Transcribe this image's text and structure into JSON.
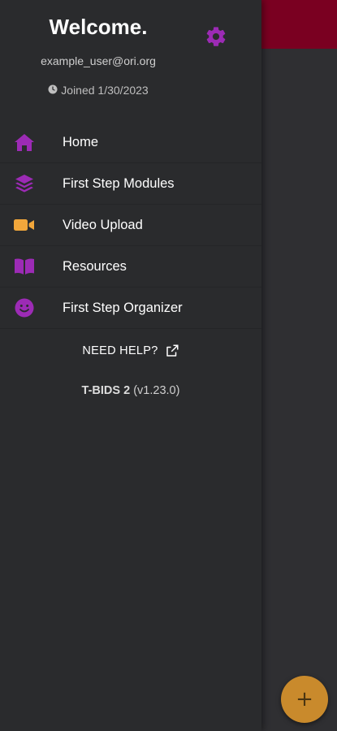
{
  "drawer": {
    "welcome": "Welcome.",
    "email": "example_user@ori.org",
    "joined": "Joined 1/30/2023",
    "icons": {
      "settings": "gear-icon",
      "joined": "clock-icon"
    },
    "menu": [
      {
        "label": "Home",
        "icon": "home-icon"
      },
      {
        "label": "First Step Modules",
        "icon": "layers-icon"
      },
      {
        "label": "Video Upload",
        "icon": "video-camera-icon"
      },
      {
        "label": "Resources",
        "icon": "book-icon"
      },
      {
        "label": "First Step Organizer",
        "icon": "smiley-icon"
      }
    ],
    "help_label": "NEED HELP?",
    "app_name": "T-BIDS 2",
    "app_version": "(v1.23.0)"
  },
  "fab": {
    "icon": "plus-icon",
    "label": "+"
  },
  "colors": {
    "accent_purple": "#9c2bb5",
    "video_orange": "#f2a73b",
    "header_maroon": "#7a0021",
    "fab_gold": "#c98a2c"
  }
}
